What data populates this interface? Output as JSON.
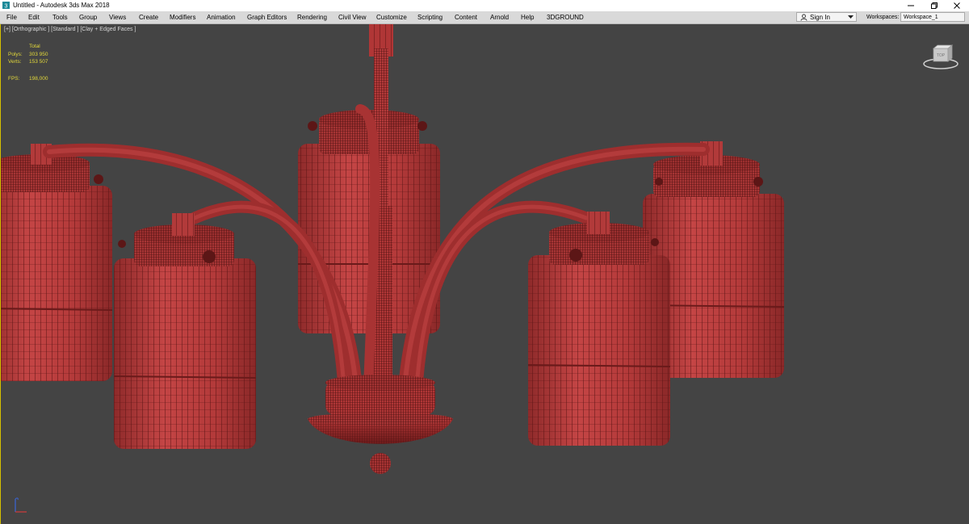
{
  "window": {
    "title": "Untitled - Autodesk 3ds Max 2018",
    "controls": [
      "minimize-icon",
      "restore-icon",
      "close-icon"
    ]
  },
  "menu": {
    "items": [
      {
        "label": "File"
      },
      {
        "label": "Edit"
      },
      {
        "label": "Tools"
      },
      {
        "label": "Group"
      },
      {
        "label": "Views"
      },
      {
        "label": "Create"
      },
      {
        "label": "Modifiers"
      },
      {
        "label": "Animation"
      },
      {
        "label": "Graph Editors"
      },
      {
        "label": "Rendering"
      },
      {
        "label": "Civil View"
      },
      {
        "label": "Customize"
      },
      {
        "label": "Scripting"
      },
      {
        "label": "Content"
      },
      {
        "label": "Arnold"
      },
      {
        "label": "Help"
      },
      {
        "label": "3DGROUND"
      }
    ],
    "signin": "Sign In",
    "workspaces_label": "Workspaces:",
    "workspace_value": "Workspace_1"
  },
  "viewport": {
    "label": "[+] [Orthographic ] [Standard ] [Clay + Edged Faces ]",
    "stats": {
      "total_header": "Total",
      "polys_label": "Polys:",
      "polys_value": "303 950",
      "verts_label": "Verts:",
      "verts_value": "153 507",
      "fps_label": "FPS:",
      "fps_value": "198,000"
    },
    "viewcube_face": "TOP"
  },
  "colors": {
    "viewport_bg": "#444444",
    "clay_fill": "#b43a3a",
    "clay_dark": "#7c2020",
    "wire": "#4a1010",
    "stats_text": "#e2d83a",
    "active_border": "#d4c000"
  }
}
